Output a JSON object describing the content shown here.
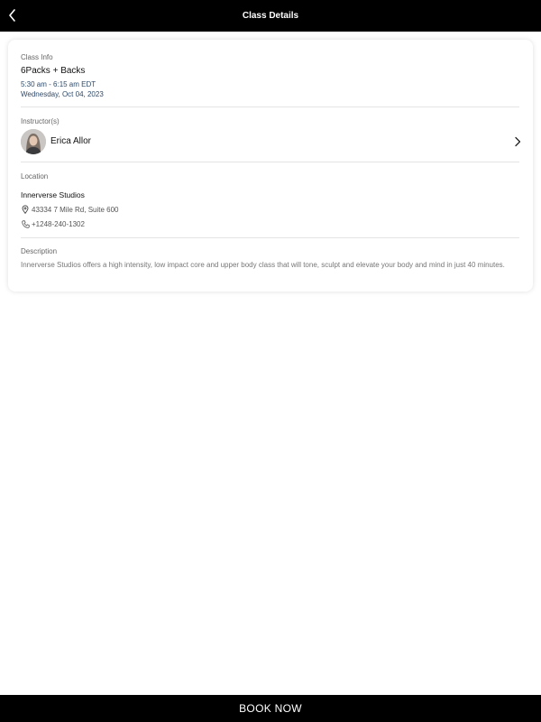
{
  "header": {
    "title": "Class Details"
  },
  "class_info": {
    "label": "Class Info",
    "name": "6Packs + Backs",
    "time": "5:30 am - 6:15 am EDT",
    "date": "Wednesday, Oct 04, 2023"
  },
  "instructors": {
    "label": "Instructor(s)",
    "items": [
      {
        "name": "Erica Allor"
      }
    ]
  },
  "location": {
    "label": "Location",
    "studio": "Innerverse Studios",
    "address": "43334 7 Mile Rd, Suite 600",
    "phone": "+1248-240-1302"
  },
  "description": {
    "label": "Description",
    "text": "Innerverse Studios offers a high intensity, low impact core and upper body class that will tone, sculpt and elevate your body and mind in just 40 minutes."
  },
  "footer": {
    "book_label": "BOOK NOW"
  },
  "icons": {
    "back": "chevron-left-icon",
    "instructor_link": "chevron-right-icon",
    "address": "map-pin-icon",
    "phone": "phone-icon"
  },
  "colors": {
    "header_bg": "#000000",
    "footer_bg": "#000000",
    "time_text": "#2f4a6a"
  }
}
